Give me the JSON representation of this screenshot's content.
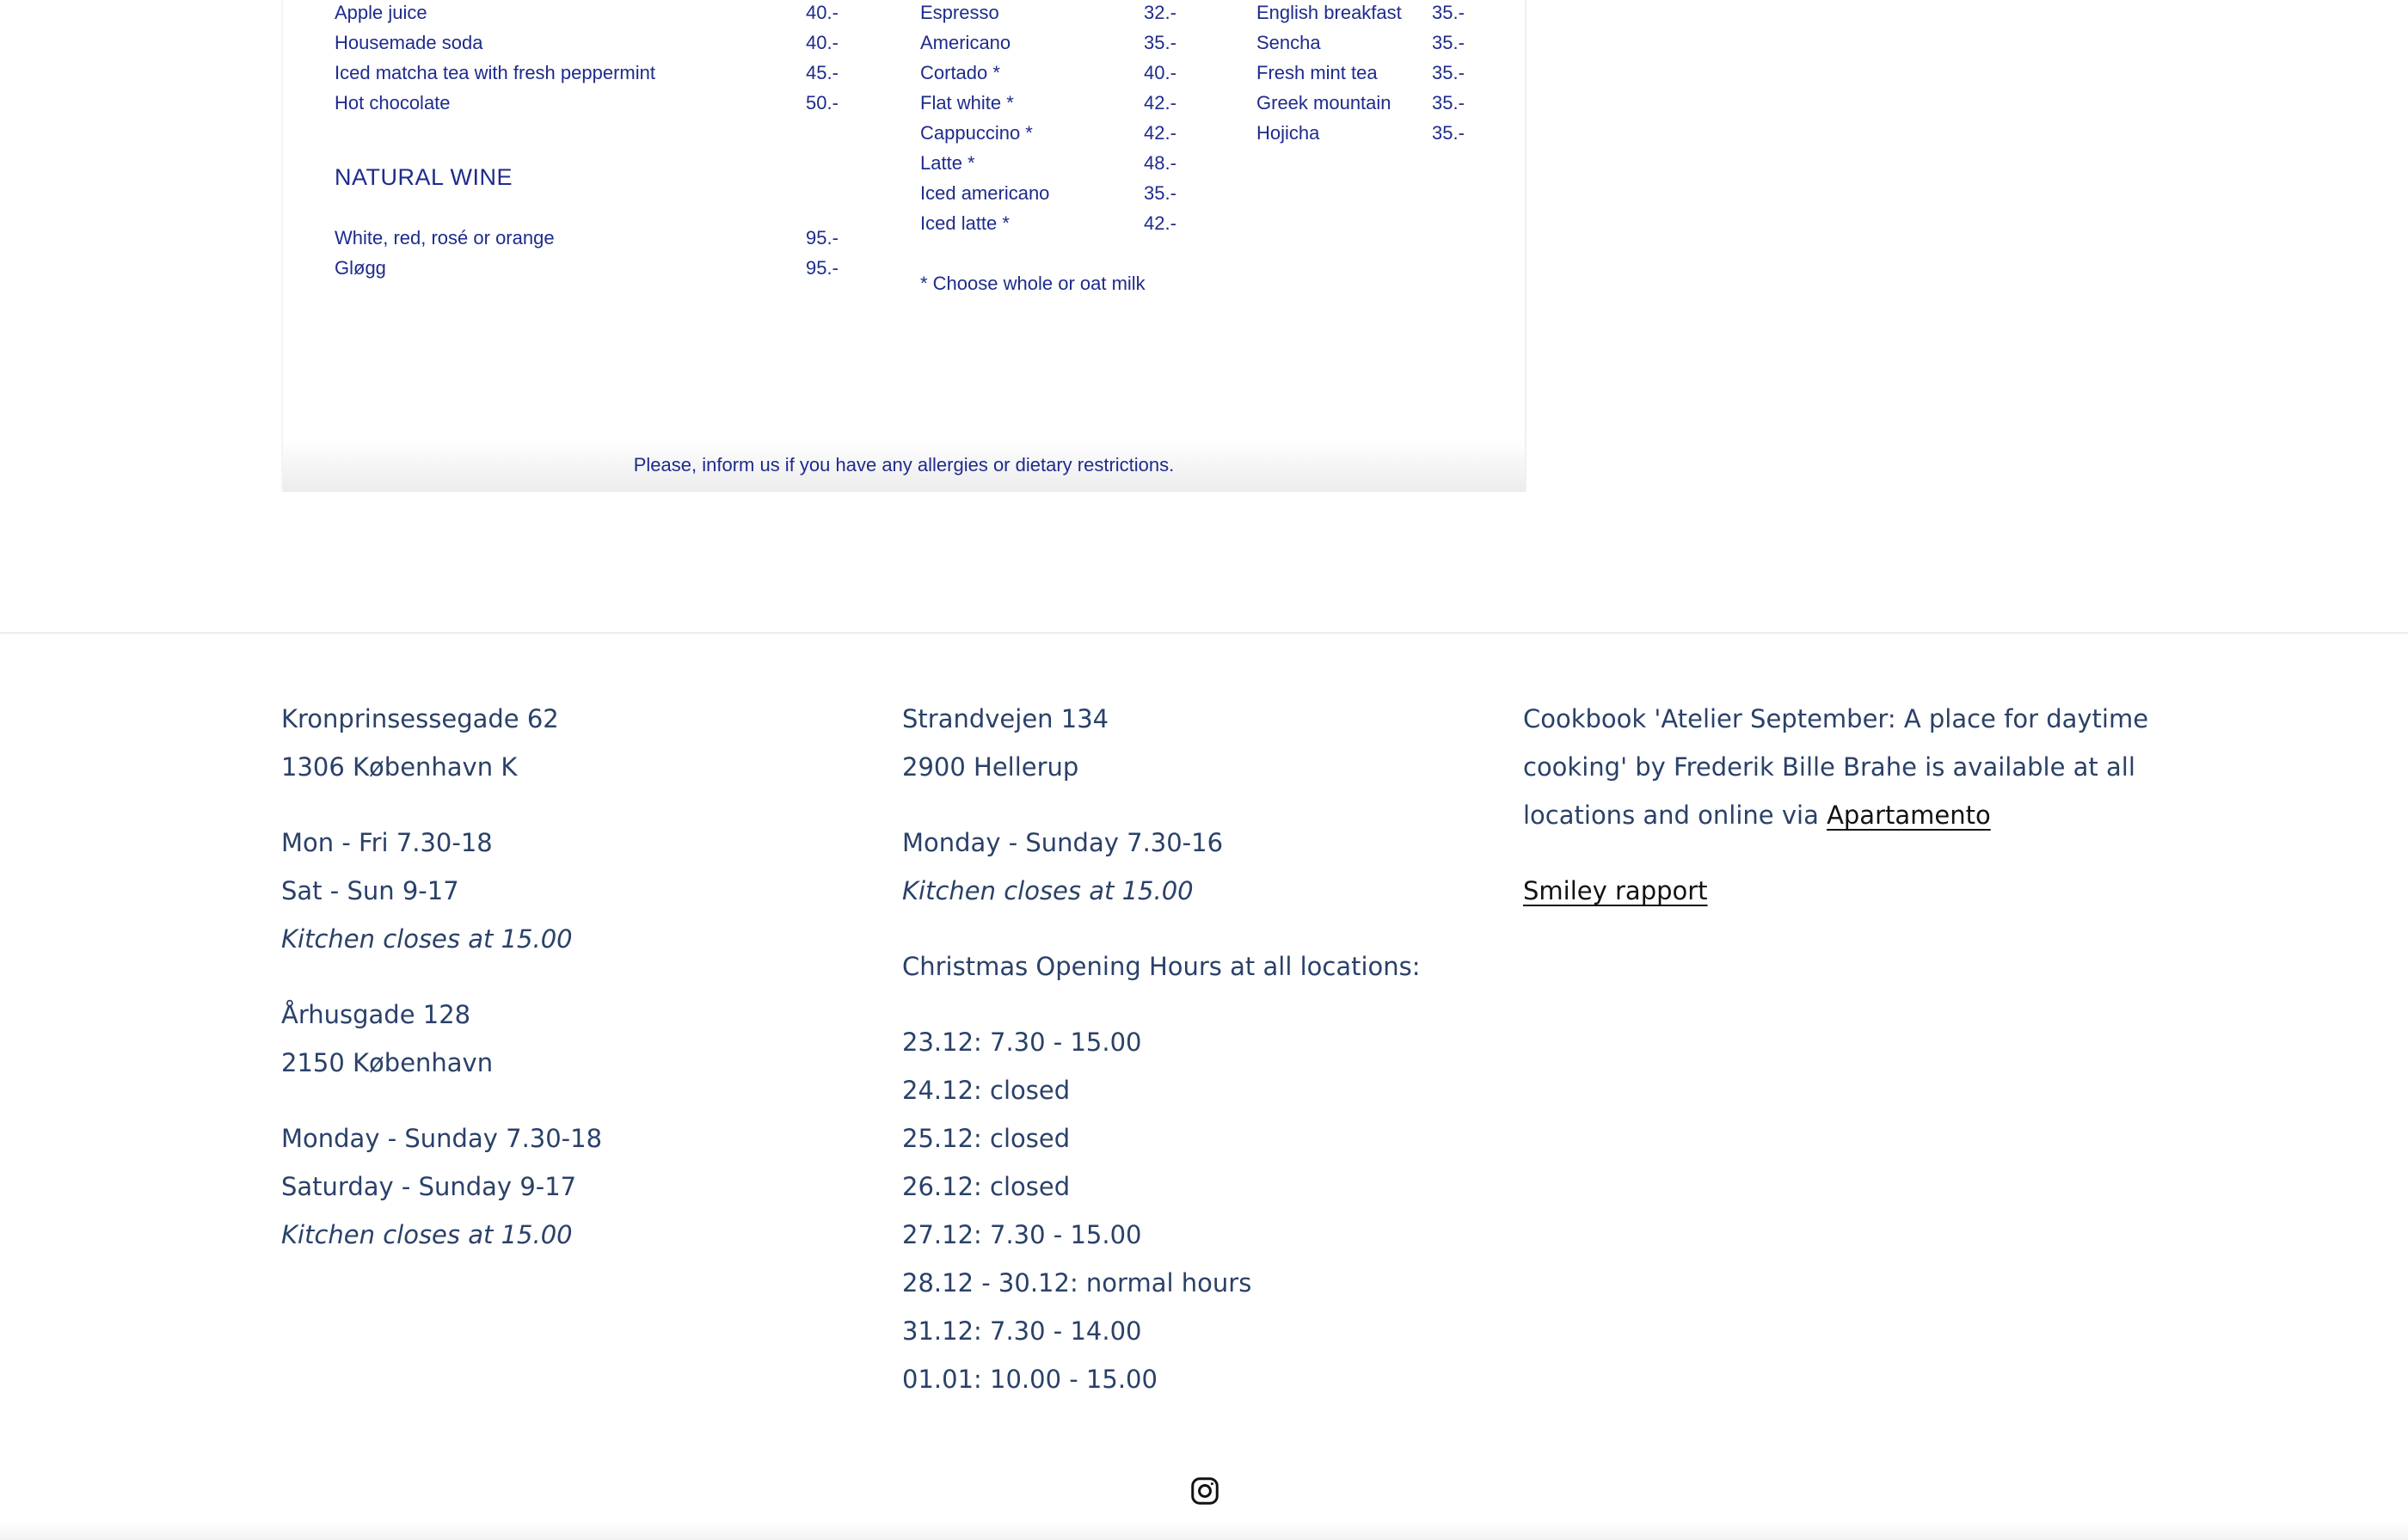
{
  "menu": {
    "drinks": [
      {
        "name": "Apple juice",
        "price": "40.-"
      },
      {
        "name": "Housemade soda",
        "price": "40.-"
      },
      {
        "name": "Iced matcha tea with fresh peppermint",
        "price": "45.-"
      },
      {
        "name": "Hot chocolate",
        "price": "50.-"
      }
    ],
    "wine_heading": "NATURAL WINE",
    "wine": [
      {
        "name": "White, red, rosé or orange",
        "price": "95.-"
      },
      {
        "name": "Gløgg",
        "price": "95.-"
      }
    ],
    "coffee": [
      {
        "name": "Espresso",
        "price": "32.-"
      },
      {
        "name": "Americano",
        "price": "35.-"
      },
      {
        "name": "Cortado *",
        "price": "40.-"
      },
      {
        "name": "Flat white *",
        "price": "42.-"
      },
      {
        "name": "Cappuccino *",
        "price": "42.-"
      },
      {
        "name": "Latte *",
        "price": "48.-"
      },
      {
        "name": "Iced americano",
        "price": "35.-"
      },
      {
        "name": "Iced latte *",
        "price": "42.-"
      }
    ],
    "milk_note": "* Choose whole or oat milk",
    "tea": [
      {
        "name": "English breakfast",
        "price": "35.-"
      },
      {
        "name": "Sencha",
        "price": "35.-"
      },
      {
        "name": "Fresh mint tea",
        "price": "35.-"
      },
      {
        "name": "Greek mountain",
        "price": "35.-"
      },
      {
        "name": "Hojicha",
        "price": "35.-"
      }
    ],
    "allergy_note": "Please, inform us if you have any allergies or dietary restrictions."
  },
  "footer": {
    "location1": {
      "street": "Kronprinsessegade 62",
      "city": "1306 København K",
      "hours1": "Mon - Fri 7.30-18",
      "hours2": "Sat - Sun 9-17",
      "kitchen": "Kitchen closes at 15.00"
    },
    "location2": {
      "street": "Århusgade 128",
      "city": "2150 København",
      "hours1": "Monday - Sunday 7.30-18",
      "hours2": "Saturday - Sunday 9-17",
      "kitchen": "Kitchen closes at 15.00"
    },
    "location3": {
      "street": "Strandvejen 134",
      "city": "2900 Hellerup",
      "hours1": "Monday - Sunday 7.30-16",
      "kitchen": "Kitchen closes at 15.00"
    },
    "christmas": {
      "heading": "Christmas Opening Hours at all locations:",
      "dates": [
        "23.12: 7.30 - 15.00",
        "24.12: closed",
        "25.12: closed",
        "26.12: closed",
        "27.12: 7.30 - 15.00",
        "28.12 - 30.12: normal hours",
        "31.12: 7.30 - 14.00",
        "01.01: 10.00 - 15.00"
      ]
    },
    "cookbook": {
      "line1": "Cookbook 'Atelier September: A place for daytime",
      "line2": "cooking' by Frederik Bille Brahe is available at all",
      "line3_prefix": "locations and online via ",
      "link": "Apartamento"
    },
    "smiley_link": "Smiley rapport",
    "social_icon": "instagram-icon"
  }
}
